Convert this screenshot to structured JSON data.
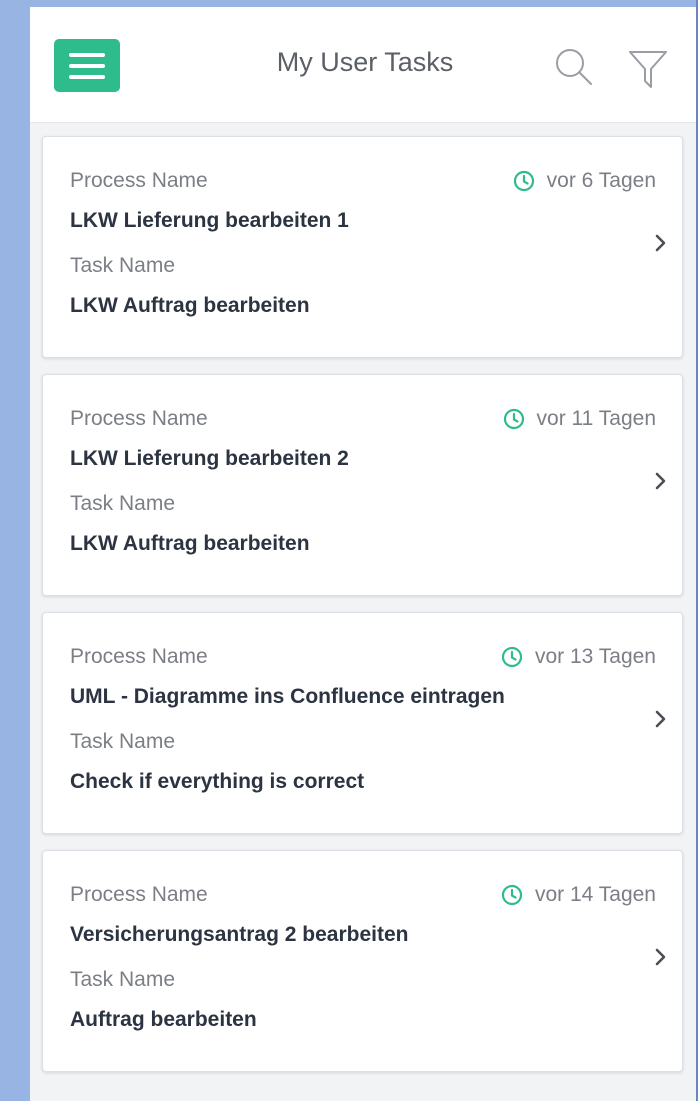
{
  "header": {
    "title": "My User Tasks",
    "accent_color": "#2ebc8c"
  },
  "icons": {
    "menu": "hamburger-menu-icon",
    "search": "search-icon",
    "filter": "filter-funnel-icon",
    "clock": "clock-icon",
    "chevron": "chevron-right-icon"
  },
  "tasks": [
    {
      "process_label": "Process Name",
      "process_name": "LKW Lieferung bearbeiten 1",
      "task_label": "Task Name",
      "task_name": "LKW Auftrag bearbeiten",
      "time": "vor 6 Tagen"
    },
    {
      "process_label": "Process Name",
      "process_name": "LKW Lieferung bearbeiten 2",
      "task_label": "Task Name",
      "task_name": "LKW Auftrag bearbeiten",
      "time": "vor 11 Tagen"
    },
    {
      "process_label": "Process Name",
      "process_name": "UML - Diagramme ins Confluence eintragen",
      "task_label": "Task Name",
      "task_name": "Check if everything is correct",
      "time": "vor 13 Tagen"
    },
    {
      "process_label": "Process Name",
      "process_name": "Versicherungsantrag 2 bearbeiten",
      "task_label": "Task Name",
      "task_name": "Auftrag bearbeiten",
      "time": "vor 14 Tagen"
    }
  ]
}
